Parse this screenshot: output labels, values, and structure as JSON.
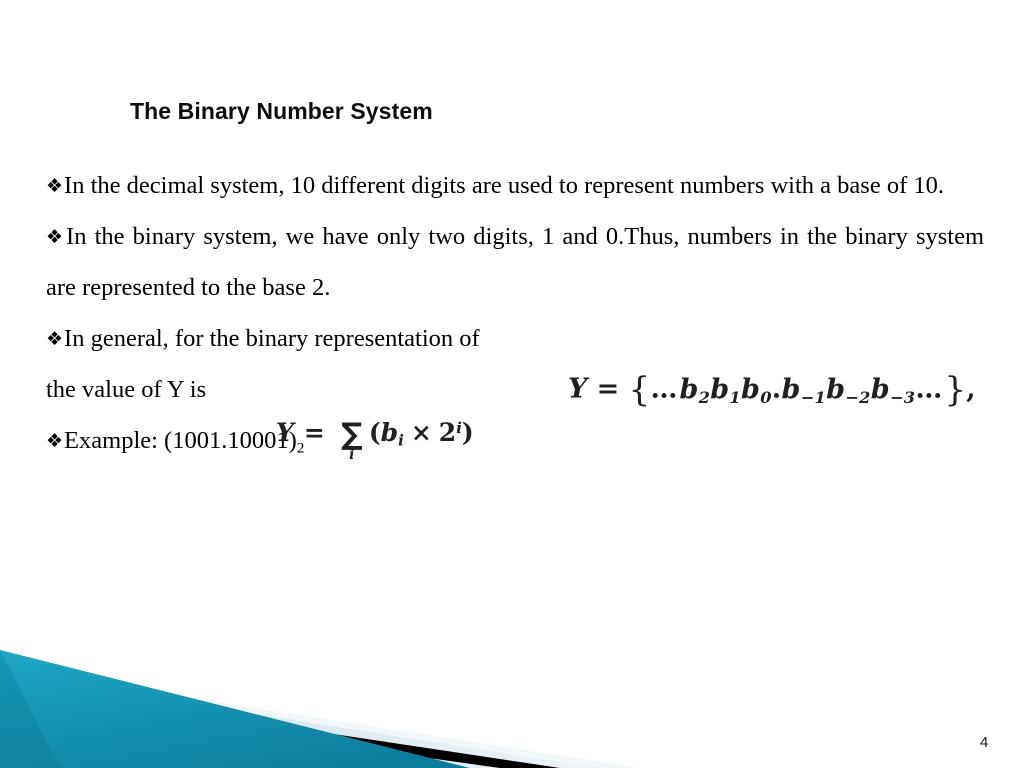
{
  "slide": {
    "title": "The Binary Number System",
    "slide_number": "4",
    "bullet_glyph": "❖",
    "background_color": "#ffffff",
    "text_color": "#000000",
    "accent_color": "#1690b2"
  },
  "bullets": [
    {
      "id": "bullet-decimal-system",
      "text": "In the decimal system, 10 different digits are used to represent numbers with a base of 10."
    },
    {
      "id": "bullet-binary-system",
      "text": "In the binary system, we have only two digits, 1 and 0.Thus, numbers in the binary system are represented to the base 2."
    },
    {
      "id": "bullet-general-representation",
      "text_before_equation": "In general, for the binary representation of",
      "text_after_equation": "the value of Y is"
    },
    {
      "id": "bullet-example",
      "label": "Example: (1001.10001)",
      "subscript": "2"
    }
  ],
  "equations": {
    "set_form": {
      "name": "binary-positional-set",
      "lhs": "Y",
      "operator": "=",
      "open_brace": "{",
      "leading_dots": "…",
      "terms": [
        {
          "base": "b",
          "sub": "2"
        },
        {
          "base": "b",
          "sub": "1"
        },
        {
          "base": "b",
          "sub": "0"
        },
        {
          "separator": "."
        },
        {
          "base": "b",
          "sub": "−1"
        },
        {
          "base": "b",
          "sub": "−2"
        },
        {
          "base": "b",
          "sub": "−3"
        }
      ],
      "trailing_dots": "…",
      "close_brace": "}",
      "trailing_punctuation": ","
    },
    "summation_form": {
      "name": "binary-value-summation",
      "lhs": "Y",
      "operator": "=",
      "sigma": "∑",
      "index": "i",
      "open_paren": "(",
      "term_base": "b",
      "term_sub": "i",
      "times": "×",
      "power_base": "2",
      "power_exp": "i",
      "close_paren": ")"
    }
  },
  "decoration": {
    "name": "bottom-corner-ribbon",
    "teal_top": "#1b9ec0",
    "teal_bottom": "#0e7d9c",
    "black": "#000000",
    "light_band": "#dce8f0"
  }
}
